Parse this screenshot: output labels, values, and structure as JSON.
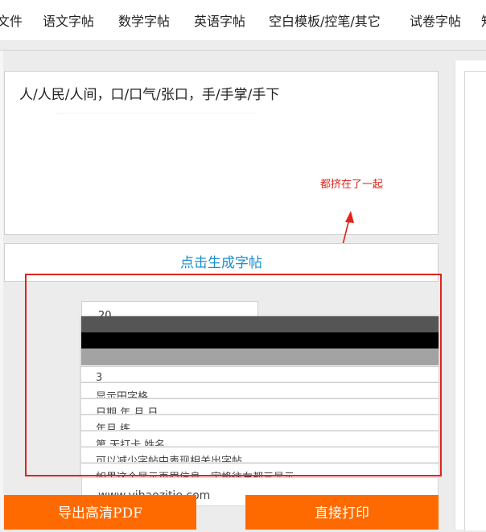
{
  "nav": {
    "items": [
      "文件",
      "语文字帖",
      "数学字帖",
      "英语字帖",
      "空白模板/控笔/其它",
      "试卷字帖",
      "知"
    ]
  },
  "editor": {
    "text": "人/人民/人间，口/口气/张口，手/手掌/手下"
  },
  "annotation": {
    "text": "都挤在了一起",
    "color": "#e0241d"
  },
  "generate": {
    "label": "点击生成字帖",
    "color": "#1a8ecf"
  },
  "settings": {
    "number_value": "20",
    "dropdown_options": [
      "3",
      "显示田字格",
      "日期          年        月        日",
      "年月   练",
      "第        天打卡   姓名",
      "可以减少字帖中表现相关出字帖",
      "如果这个显示页眉信息，字格往右都三显示"
    ],
    "swatch_colors": [
      "#555555",
      "#000000",
      "#a3a3a3"
    ],
    "url": "www.yihaozitie.com"
  },
  "actions": {
    "export_label": "导出高清PDF",
    "print_label": "直接打印",
    "accent": "#ff6a00"
  }
}
